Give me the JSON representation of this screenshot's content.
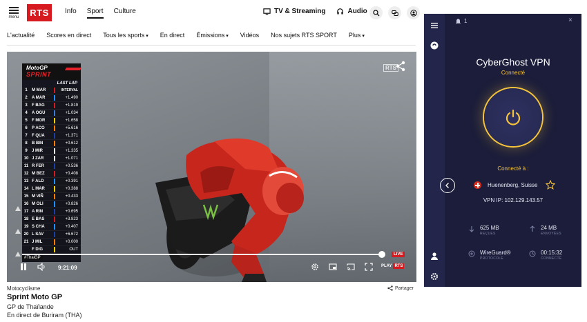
{
  "rts": {
    "menu_label": "menu",
    "logo": "RTS",
    "nav": [
      "Info",
      "Sport",
      "Culture"
    ],
    "nav_active": "Sport",
    "tv_streaming": "TV & Streaming",
    "audio": "Audio",
    "sub_nav": {
      "actualite": "L'actualité",
      "scores": "Scores en direct",
      "tous_sports": "Tous les sports",
      "en_direct": "En direct",
      "emissions": "Émissions",
      "videos": "Vidéos",
      "nos_sujets": "Nos sujets RTS SPORT",
      "plus": "Plus"
    }
  },
  "video": {
    "watermark": "RTS",
    "tower_title": "LAST LAP",
    "tower_logo_top": "MotoGP",
    "tower_logo_sprint": "SPRINT",
    "tower_interval_label": "INTERVAL",
    "hashtag": "#ThaiGP",
    "time": "9:21:09",
    "live": "LIVE",
    "play_label": "PLAY",
    "play_brand": "RTS",
    "riders": [
      {
        "pos": "1",
        "name": "M MAR",
        "gap": "INTERVAL",
        "color": "#d61a1f"
      },
      {
        "pos": "2",
        "name": "A MAR",
        "gap": "+1.490",
        "color": "#1e90ff"
      },
      {
        "pos": "3",
        "name": "F BAG",
        "gap": "+1.819",
        "color": "#d61a1f"
      },
      {
        "pos": "4",
        "name": "A OGU",
        "gap": "+1.034",
        "color": "#3b7bd9"
      },
      {
        "pos": "5",
        "name": "F MOR",
        "gap": "+1.658",
        "color": "#ffd200"
      },
      {
        "pos": "6",
        "name": "P ACO",
        "gap": "+5.616",
        "color": "#ff7a00"
      },
      {
        "pos": "7",
        "name": "F QUA",
        "gap": "+1.371",
        "color": "#1a3fa8"
      },
      {
        "pos": "8",
        "name": "B BIN",
        "gap": "+0.612",
        "color": "#ff7a00"
      },
      {
        "pos": "9",
        "name": "J MIR",
        "gap": "+1.335",
        "color": "#e8e8e8"
      },
      {
        "pos": "10",
        "name": "J ZAR",
        "gap": "+1.071",
        "color": "#e8e8e8"
      },
      {
        "pos": "11",
        "name": "R FER",
        "gap": "+0.536",
        "color": "#1a3fa8"
      },
      {
        "pos": "12",
        "name": "M BEZ",
        "gap": "+0.408",
        "color": "#d61a1f"
      },
      {
        "pos": "13",
        "name": "F ALD",
        "gap": "+0.391",
        "color": "#1e90ff"
      },
      {
        "pos": "14",
        "name": "L MAR",
        "gap": "+0.388",
        "color": "#ffd200"
      },
      {
        "pos": "15",
        "name": "M VIÑ",
        "gap": "+0.433",
        "color": "#ff7a00"
      },
      {
        "pos": "16",
        "name": "M OLI",
        "gap": "+0.826",
        "color": "#1e90ff"
      },
      {
        "pos": "17",
        "name": "A RIN",
        "gap": "+0.695",
        "color": "#1a3fa8"
      },
      {
        "pos": "18",
        "name": "E BAS",
        "gap": "+3.823",
        "color": "#d61a1f"
      },
      {
        "pos": "19",
        "name": "S CHA",
        "gap": "+0.407",
        "color": "#1e90ff"
      },
      {
        "pos": "20",
        "name": "L SAV",
        "gap": "+6.672",
        "color": "#1a3fa8"
      },
      {
        "pos": "21",
        "name": "J MIL",
        "gap": "+0.000",
        "color": "#ff7a00"
      },
      {
        "pos": "",
        "name": "F DIG",
        "gap": "OUT",
        "color": "#ffd200"
      }
    ]
  },
  "article": {
    "category": "Motocyclisme",
    "share": "Partager",
    "title": "Sprint Moto GP",
    "subtitle": "GP de Thaïlande",
    "location": "En direct de Buriram (THA)"
  },
  "cyberghost": {
    "notifications": "1",
    "close": "×",
    "title": "CyberGhost VPN",
    "status": "Connecté",
    "connected_to": "Connecté à :",
    "location": "Huenenberg, Suisse",
    "vpn_ip": "VPN IP: 102.129.143.57",
    "received_value": "625 MB",
    "received_label": "REÇUES",
    "sent_value": "24 MB",
    "sent_label": "ENVOYÉES",
    "protocol_value": "WireGuard®",
    "protocol_label": "PROTOCOLE",
    "duration_value": "00:15:32",
    "duration_label": "CONNECTÉ",
    "accent_color": "#f7c53c"
  }
}
